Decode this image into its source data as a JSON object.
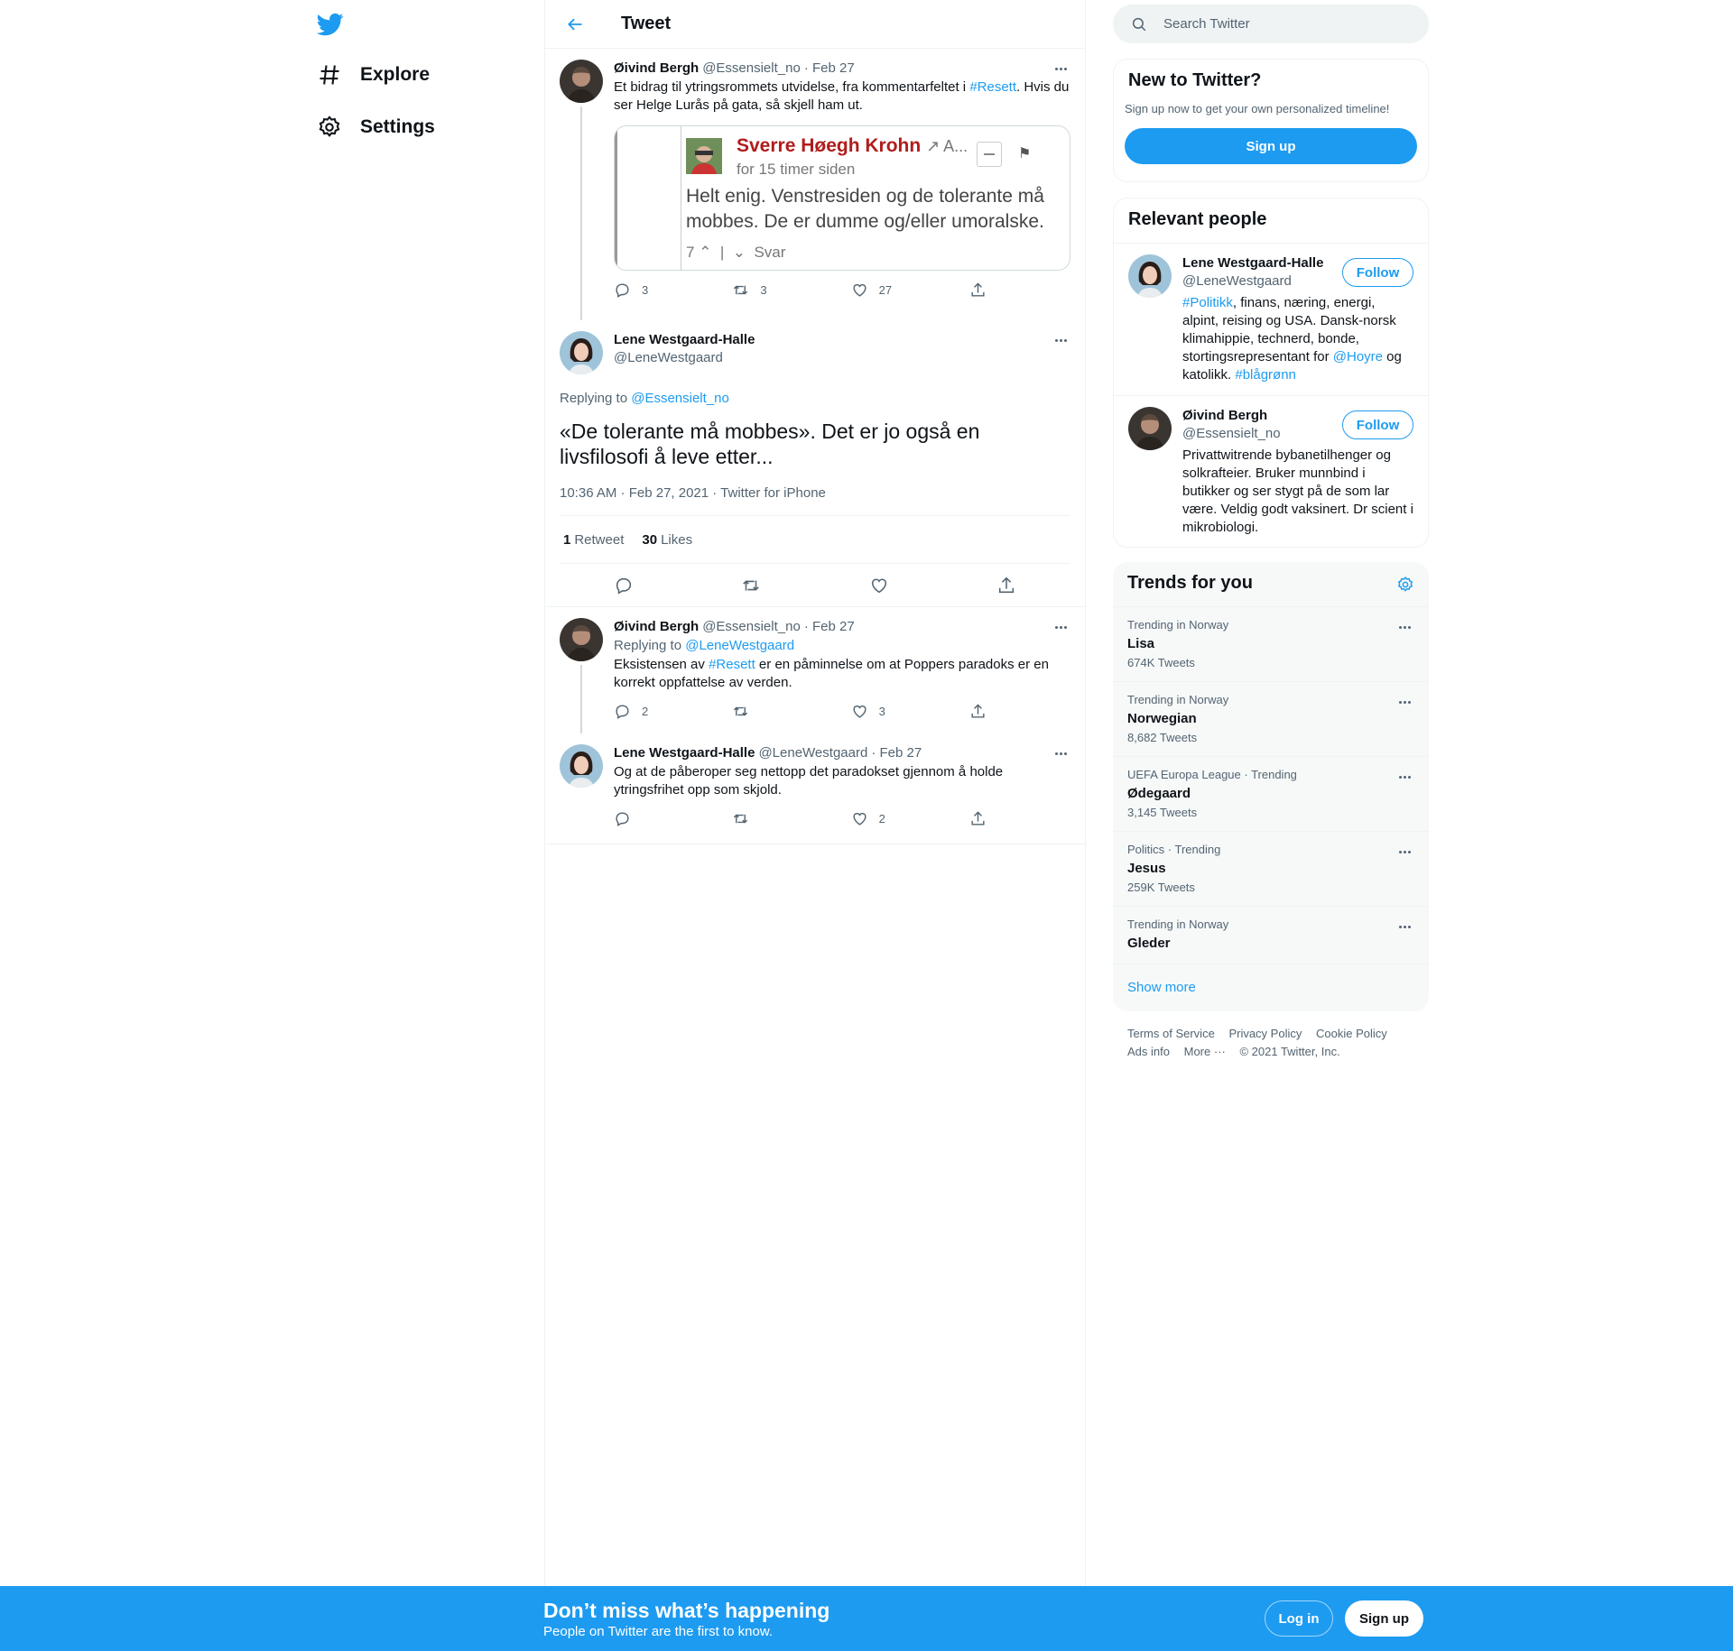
{
  "nav": {
    "logo": "twitter-bird",
    "items": [
      {
        "label": "Explore",
        "icon": "hashtag-icon"
      },
      {
        "label": "Settings",
        "icon": "gear-icon"
      }
    ]
  },
  "header": {
    "title": "Tweet"
  },
  "thread": {
    "parent": {
      "name": "Øivind Bergh",
      "handle": "@Essensielt_no",
      "date": "· Feb 27",
      "text_before": "Et bidrag til ytringsrommets utvidelse, fra kommentarfeltet i ",
      "hashtag": "#Resett",
      "text_after": ". Hvis du ser Helge Lurås på gata, så skjell ham ut.",
      "replies": "3",
      "retweets": "3",
      "likes": "27",
      "embed": {
        "author": "Sverre Høegh Krohn",
        "author_suffix": "A...",
        "time": "for 15 timer siden",
        "comment": "Helt enig. Venstresiden og de tolerante må mobbes. De er dumme og/eller umoralske.",
        "votes": "7",
        "reply_label": "Svar"
      }
    },
    "focused": {
      "name": "Lene Westgaard-Halle",
      "handle": "@LeneWestgaard",
      "replying_prefix": "Replying to ",
      "replying_to": "@Essensielt_no",
      "text": "«De tolerante må mobbes». Det er jo også en livsfilosofi å leve etter...",
      "meta": "10:36 AM · Feb 27, 2021 · Twitter for iPhone",
      "retweet_count": "1",
      "retweet_label": "Retweet",
      "like_count": "30",
      "like_label": "Likes"
    },
    "replies": [
      {
        "name": "Øivind Bergh",
        "handle": "@Essensielt_no",
        "date": "· Feb 27",
        "replying_prefix": "Replying to ",
        "replying_to": "@LeneWestgaard",
        "text_before": "Eksistensen av ",
        "hashtag": "#Resett",
        "text_after": " er en påminnelse om at Poppers paradoks er en korrekt oppfattelse av verden.",
        "replies": "2",
        "retweets": "",
        "likes": "3"
      },
      {
        "name": "Lene Westgaard-Halle",
        "handle": "@LeneWestgaard",
        "date": "· Feb 27",
        "text": "Og at de påberoper seg nettopp det paradokset gjennom å holde ytringsfrihet opp som skjold.",
        "replies": "",
        "retweets": "",
        "likes": "2"
      }
    ]
  },
  "search": {
    "placeholder": "Search Twitter"
  },
  "new_to_twitter": {
    "title": "New to Twitter?",
    "subtitle": "Sign up now to get your own personalized timeline!",
    "button": "Sign up"
  },
  "relevant": {
    "title": "Relevant people",
    "follow_label": "Follow",
    "people": [
      {
        "name": "Lene Westgaard-Halle",
        "handle": "@LeneWestgaard",
        "bio_tag1": "#Politikk",
        "bio_mid": ", finans, næring, energi, alpint, reising og USA. Dansk-norsk klimahippie, technerd, bonde, stortingsrepresentant for ",
        "bio_tag2": "@Hoyre",
        "bio_end": " og katolikk. ",
        "bio_tag3": "#blågrønn"
      },
      {
        "name": "Øivind Bergh",
        "handle": "@Essensielt_no",
        "bio": "Privattwitrende bybanetilhenger og solkrafteier. Bruker munnbind i butikker og ser stygt på de som lar være. Veldig godt vaksinert. Dr scient i mikrobiologi."
      }
    ]
  },
  "trends": {
    "title": "Trends for you",
    "items": [
      {
        "context": "Trending in Norway",
        "name": "Lisa",
        "count": "674K Tweets"
      },
      {
        "context": "Trending in Norway",
        "name": "Norwegian",
        "count": "8,682 Tweets"
      },
      {
        "context": "UEFA Europa League · Trending",
        "name": "Ødegaard",
        "count": "3,145 Tweets"
      },
      {
        "context": "Politics · Trending",
        "name": "Jesus",
        "count": "259K Tweets"
      },
      {
        "context": "Trending in Norway",
        "name": "Gleder",
        "count": ""
      }
    ],
    "show_more": "Show more"
  },
  "footer": {
    "links": [
      "Terms of Service",
      "Privacy Policy",
      "Cookie Policy",
      "Ads info",
      "More ···"
    ],
    "copyright": "© 2021 Twitter, Inc."
  },
  "bottom_bar": {
    "title": "Don’t miss what’s happening",
    "subtitle": "People on Twitter are the first to know.",
    "login": "Log in",
    "signup": "Sign up"
  },
  "colors": {
    "accent": "#1d9bf0",
    "text": "#0f1419",
    "secondary": "#536471",
    "border": "#eff3f4"
  }
}
